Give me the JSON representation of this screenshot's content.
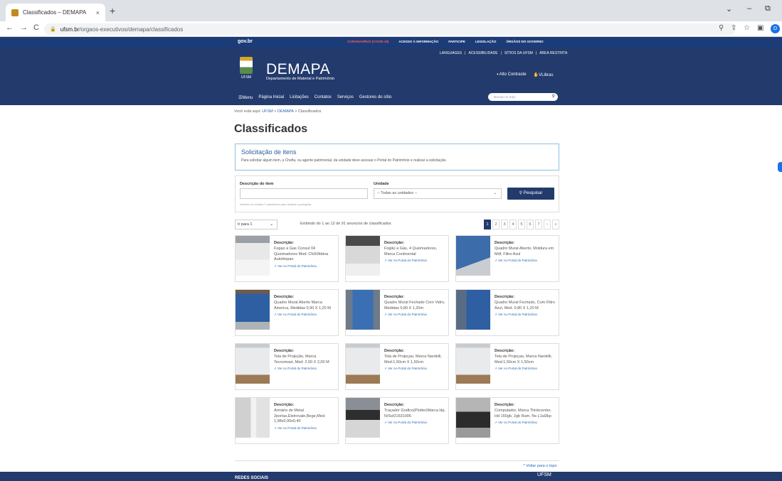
{
  "browser": {
    "tab_title": "Classificados – DEMAPA",
    "tab_close": "×",
    "new_tab": "+",
    "url_domain": "ufsm.br",
    "url_path": "/orgaos-executivos/demapa/classificados",
    "profile_initial": "D",
    "win_min": "–",
    "win_max": "⧉",
    "win_down": "⌄",
    "back": "←",
    "forward": "→",
    "reload": "C"
  },
  "govbar": {
    "logo": "gov.br",
    "links": [
      "CORONAVÍRUS (COVID-19)",
      "ACESSO À INFORMAÇÃO",
      "PARTICIPE",
      "LEGISLAÇÃO",
      "ÓRGÃOS DO GOVERNO"
    ]
  },
  "header": {
    "top_links": [
      "LANGUAGES",
      "ACESSIBILIDADE",
      "SÍTIOS DA UFSM",
      "ÁREA RESTRITA"
    ],
    "logo_text": "UFSM",
    "title": "DEMAPA",
    "subtitle": "Departamento de Material e Patrimônio",
    "high_contrast": "Alto Contraste",
    "vlibras": "VLibras",
    "nav": [
      "Menu",
      "Página Inicial",
      "Licitações",
      "Contatos",
      "Serviços",
      "Gestores do sítio"
    ],
    "search_placeholder": "Buscar no Sítio"
  },
  "breadcrumb": {
    "prefix": "Você está aqui:",
    "items": [
      "UFSM",
      "DEMAPA",
      "Classificados"
    ]
  },
  "page_title": "Classificados",
  "info": {
    "title": "Solicitação de itens",
    "text": "Para solicitar algum item, a Chefia, ou agente patrimonial, da unidade deve acessar o Portal do Patrimônio e realizar a solicitação."
  },
  "search": {
    "desc_label": "Descrição do item",
    "unit_label": "Unidade",
    "unit_value": "-- Todas as unidades --",
    "hint": "Informe no mínimo 3 caracteres para realizar a pesquisa",
    "button": "Pesquisar"
  },
  "listing": {
    "goto": "Ir para 1",
    "showing": "Exibindo do 1 ao 12 de 91 anuncios de classificados",
    "pages": [
      "1",
      "2",
      "3",
      "4",
      "5",
      "6",
      "7",
      "›",
      "»"
    ]
  },
  "cards": [
    {
      "label": "Descrição:",
      "desc": "Fogao a Gas Consul 04 Queimadores Mod: Cfs50bbina Autolimpan",
      "link": "Ver no Portal do Patrimônio",
      "thumb": "stove"
    },
    {
      "label": "Descrição:",
      "desc": "Fogão a Gás, 4 Queimadores, Marca Continental",
      "link": "Ver no Portal do Patrimônio",
      "thumb": "stove2"
    },
    {
      "label": "Descrição:",
      "desc": "Quadro Mural Aberto, Moldura em Mdf, Filtro Azul",
      "link": "Ver no Portal do Patrimônio",
      "thumb": "board-blue"
    },
    {
      "label": "Descrição:",
      "desc": "Quadro Mural Aberto Marca America, Medidas 0,90 X 1,20 M",
      "link": "Ver no Portal do Patrimônio",
      "thumb": "board-blue2"
    },
    {
      "label": "Descrição:",
      "desc": "Quadro Mural Fechado Com Vidro, Medidas 0,80 X 1,20m",
      "link": "Ver no Portal do Patrimônio",
      "thumb": "board-closed"
    },
    {
      "label": "Descrição:",
      "desc": "Quadro Mural Fechado, Com Filtro Azul, Med. 0,80 X 1,20 M",
      "link": "Ver no Portal do Patrimônio",
      "thumb": "board-mesh"
    },
    {
      "label": "Descrição:",
      "desc": "Tela de Projeção, Marca Tecnomast, Med: 2,00 X 2,00 M",
      "link": "Ver no Portal do Patrimônio",
      "thumb": "screen"
    },
    {
      "label": "Descrição:",
      "desc": "Tela de Projeçao, Marca Nardelli, Med:1,50cm X 1,50cm",
      "link": "Ver no Portal do Patrimônio",
      "thumb": "screen"
    },
    {
      "label": "Descrição:",
      "desc": "Tela de Projeçao, Marca Nardelli, Med:1,50cm X 1,50cm",
      "link": "Ver no Portal do Patrimônio",
      "thumb": "screen"
    },
    {
      "label": "Descrição:",
      "desc": "Armário de Metal 2portas,Eletrovale,Bege,Med. 1,98x0,90x0,40",
      "link": "Ver no Portal do Patrimônio",
      "thumb": "cabinet"
    },
    {
      "label": "Descrição:",
      "desc": "Traçador Grafico(Plotter)Marca Hp, N/Ssf21631006",
      "link": "Ver no Portal do Patrimônio",
      "thumb": "plotter"
    },
    {
      "label": "Descrição:",
      "desc": "Computador, Marca Thinkcenter, Hd 160gb, 2gb Ram, Ns L1al3kp",
      "link": "Ver no Portal do Patrimônio",
      "thumb": "computer"
    }
  ],
  "back_to_top": "Voltar para o topo",
  "footer": {
    "social": "REDES SOCIAIS",
    "logo": "UFSM"
  }
}
